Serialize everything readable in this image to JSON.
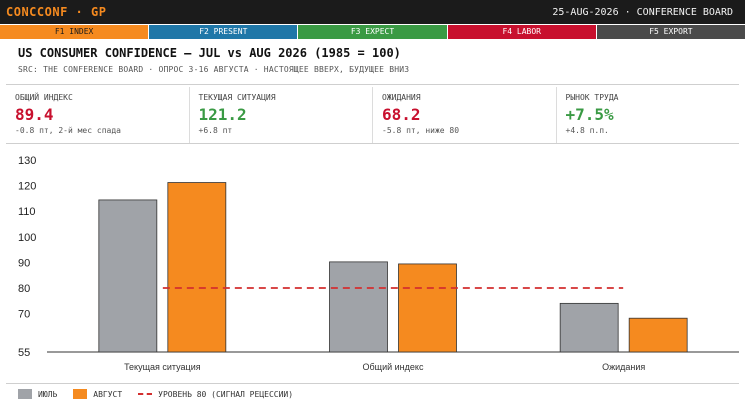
{
  "header": {
    "brand": "CONCCONF · GP",
    "date_source": "25-AUG-2026 · CONFERENCE BOARD"
  },
  "fkeys": [
    {
      "label": "F1 INDEX",
      "color": "#f58a1f",
      "active": true
    },
    {
      "label": "F2 PRESENT",
      "color": "#1f77a8",
      "active": false
    },
    {
      "label": "F3 EXPECT",
      "color": "#3a9a44",
      "active": false
    },
    {
      "label": "F4 LABOR",
      "color": "#c8102e",
      "active": false
    },
    {
      "label": "F5 EXPORT",
      "color": "#4a4a4a",
      "active": false
    }
  ],
  "chart_title": "US CONSUMER CONFIDENCE — JUL vs AUG 2026 (1985 = 100)",
  "chart_subtitle": "SRC: THE CONFERENCE BOARD · ОПРОС 3-16 АВГУСТА · НАСТОЯЩЕЕ ВВЕРХ, БУДУЩЕЕ ВНИЗ",
  "kpis": [
    {
      "label": "ОБЩИЙ ИНДЕКС",
      "value": "89.4",
      "delta": "-0.8 пт, 2-й мес спада",
      "color": "#c8102e"
    },
    {
      "label": "ТЕКУЩАЯ СИТУАЦИЯ",
      "value": "121.2",
      "delta": "+6.8 пт",
      "color": "#3a9a44"
    },
    {
      "label": "ОЖИДАНИЯ",
      "value": "68.2",
      "delta": "-5.8 пт, ниже 80",
      "color": "#c8102e"
    },
    {
      "label": "РЫНОК ТРУДА",
      "value": "+7.5%",
      "delta": "+4.8 п.п.",
      "color": "#3a9a44"
    }
  ],
  "chart_data": {
    "type": "bar",
    "categories": [
      "Текущая ситуация",
      "Общий индекс",
      "Ожидания"
    ],
    "series": [
      {
        "name": "ИЮЛЬ",
        "values": [
          114.4,
          90.2,
          74.0
        ],
        "color": "#a0a3a8"
      },
      {
        "name": "АВГУСТ",
        "values": [
          121.2,
          89.4,
          68.2
        ],
        "color": "#f58a1f"
      }
    ],
    "yticks": [
      55,
      70,
      80,
      90,
      100,
      110,
      120,
      130
    ],
    "ylim": [
      55,
      130
    ],
    "reference_line": {
      "value": 80,
      "label": "УРОВЕНЬ 80 (СИГНАЛ РЕЦЕССИИ)",
      "color": "#d32f2f"
    },
    "grid": false,
    "legend_position": "bottom-left"
  }
}
